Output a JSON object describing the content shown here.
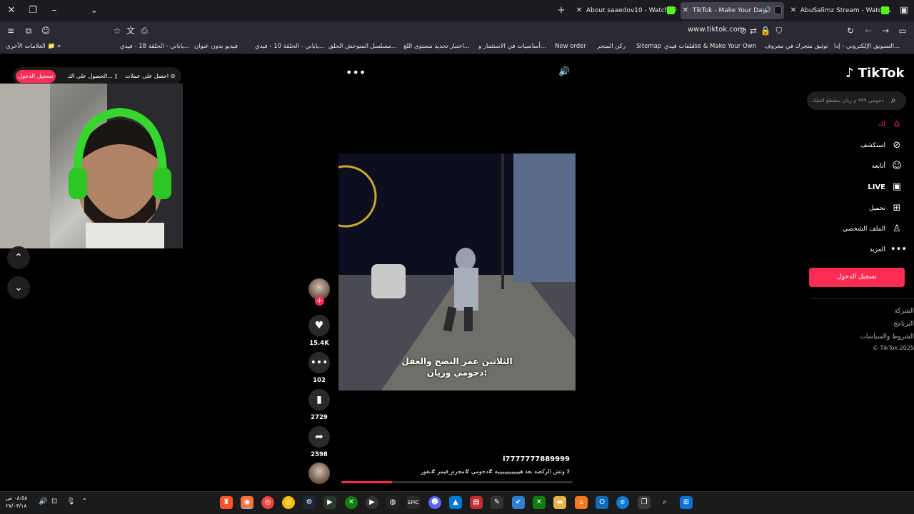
{
  "tabs": [
    {
      "label": "About saaedov10 - Watch Live",
      "active": false
    },
    {
      "label": "TikTok - Make Your Day",
      "active": true
    },
    {
      "label": "AbuSalimz Stream - Watch Live",
      "active": false
    }
  ],
  "address": {
    "url": "www.tiktok.com"
  },
  "bookmarks": {
    "other": "العلامات الأخرى",
    "items": [
      "ياباني - الحلقة 18 - فيدي...",
      "فيديو بدون عنوان",
      "ياباني - الحلقة 10 - فيدي...",
      "مسلسل المتوحش الحلق...",
      "اختبار تحديد مستوى اللغ...",
      "أساسيات في الاستثمار و...",
      "New order",
      "ركن المتجر",
      "Sitemap",
      "ملفات فيدي",
      "ise & Make Your Own",
      "توثيق متجرك في معروف",
      "التسويق الإلكتروني - إدا..."
    ]
  },
  "top_buttons": {
    "login": "تسجيل الدخول",
    "get_app": "الحصول على التـ...",
    "get_coins": "احصل على عملات"
  },
  "video": {
    "caption_line1": "الثلاثين عمر النضج والعقل",
    "caption_line2": "دحومي وريان:",
    "author": "l7777777889999",
    "description": "لا وتش الركضه بعد هيييييييييييييه #دحومي #مجرم_قيمز #بقور",
    "progress": 0.22
  },
  "actions": {
    "likes": "15.4K",
    "comments": "102",
    "saves": "2729",
    "shares": "2598"
  },
  "sidebar": {
    "logo": "TikTok",
    "search_placeholder": "دحومي ٩٩٩ و ريان بمقطع الملك",
    "nav": [
      "لك",
      "استكشف",
      "أتابعه",
      "LIVE",
      "تحميل",
      "الملف الشخصي",
      "المزيد"
    ],
    "login": "تسجيل الدخول",
    "footer": [
      "الشركة",
      "البرنامج",
      "الشروط والسياسات",
      "© TikTok 2025"
    ]
  },
  "taskbar": {
    "time": "٠٨:٥٨ ص",
    "date": "٢٧/٠٣/١٨"
  },
  "colors": {
    "accent": "#fe2c55",
    "tab_bg": "#1c1b22",
    "toolbar_bg": "#2b2a33"
  }
}
